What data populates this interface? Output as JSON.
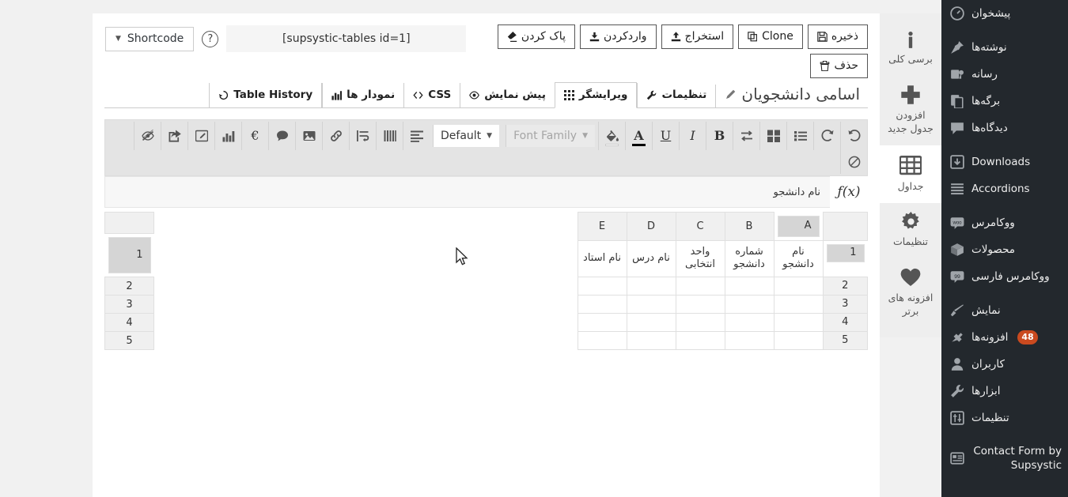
{
  "wp_sidebar": {
    "items": [
      {
        "label": "پیشخوان",
        "icon": "dashboard-icon",
        "badge": null
      },
      {
        "label": "نوشته‌ها",
        "icon": "pin-icon",
        "badge": null
      },
      {
        "label": "رسانه",
        "icon": "media-icon",
        "badge": null
      },
      {
        "label": "برگه‌ها",
        "icon": "pages-icon",
        "badge": null
      },
      {
        "label": "دیدگاه‌ها",
        "icon": "comment-icon",
        "badge": null
      },
      {
        "label": "Downloads",
        "icon": "download-icon",
        "badge": null
      },
      {
        "label": "Accordions",
        "icon": "list-icon",
        "badge": null
      },
      {
        "label": "ووکامرس",
        "icon": "woo-icon",
        "badge": null
      },
      {
        "label": "محصولات",
        "icon": "box-icon",
        "badge": null
      },
      {
        "label": "ووکامرس فارسی",
        "icon": "woo-fa-icon",
        "badge": null
      },
      {
        "label": "نمایش",
        "icon": "appearance-icon",
        "badge": null
      },
      {
        "label": "افزونه‌ها",
        "icon": "plugin-icon",
        "badge": "48"
      },
      {
        "label": "کاربران",
        "icon": "users-icon",
        "badge": null
      },
      {
        "label": "ابزارها",
        "icon": "tools-icon",
        "badge": null
      },
      {
        "label": "تنظیمات",
        "icon": "settings-icon",
        "badge": null
      },
      {
        "label": "Contact Form by Supsystic",
        "icon": "contact-form-icon",
        "badge": null
      }
    ]
  },
  "rail": {
    "items": [
      {
        "label": "برسی کلی",
        "icon": "info-icon",
        "active": false
      },
      {
        "label": "افزودن جدول جدید",
        "icon": "plus-icon",
        "active": false
      },
      {
        "label": "جداول",
        "icon": "table-icon",
        "active": true
      },
      {
        "label": "تنظیمات",
        "icon": "gear-icon",
        "active": false
      },
      {
        "label": "افزونه های برتر",
        "icon": "heart-icon",
        "active": false
      }
    ]
  },
  "shortcode": {
    "select_label": "Shortcode",
    "help_label": "?",
    "value": "[supsystic-tables id=1]"
  },
  "actions": [
    {
      "label": "ذخیره",
      "icon": "save-icon"
    },
    {
      "label": "Clone",
      "icon": "clone-icon"
    },
    {
      "label": "استخراج",
      "icon": "export-icon"
    },
    {
      "label": "واردکردن",
      "icon": "import-icon"
    },
    {
      "label": "پاک کردن",
      "icon": "eraser-icon"
    },
    {
      "label": "حذف",
      "icon": "trash-icon"
    }
  ],
  "table_title": "اسامی دانشجویان",
  "tabs": [
    {
      "label": "تنظیمات",
      "icon": "wrench-icon",
      "active": false
    },
    {
      "label": "ویرایشگر",
      "icon": "grid-icon",
      "active": true
    },
    {
      "label": "پیش نمایش",
      "icon": "eye-icon",
      "active": false
    },
    {
      "label": "CSS",
      "icon": "code-icon",
      "active": false
    },
    {
      "label": "نمودار ها",
      "icon": "chart-icon",
      "active": false
    },
    {
      "label": "Table History",
      "icon": "history-icon",
      "active": false
    }
  ],
  "toolbar": {
    "right_group": [
      {
        "icon": "undo-icon",
        "name": "undo-button"
      },
      {
        "icon": "redo-icon",
        "name": "redo-button"
      },
      {
        "icon": "list-icon",
        "name": "list-button"
      },
      {
        "icon": "merge-cells-icon",
        "name": "merge-cells-button"
      },
      {
        "icon": "swap-icon",
        "name": "swap-button"
      },
      {
        "icon": "bold-icon",
        "name": "bold-button",
        "letter": "B"
      },
      {
        "icon": "italic-icon",
        "name": "italic-button",
        "letter": "I"
      },
      {
        "icon": "underline-icon",
        "name": "underline-button",
        "letter": "U"
      },
      {
        "icon": "text-color-icon",
        "name": "text-color-button",
        "letter": "A",
        "swatch": "#000000"
      },
      {
        "icon": "fill-color-icon",
        "name": "fill-color-button",
        "swatch": "#ffffff"
      }
    ],
    "font_family_label": "Font Family",
    "default_label": "Default",
    "left_group": [
      {
        "icon": "align-icon",
        "name": "align-button"
      },
      {
        "icon": "columns-icon",
        "name": "columns-button"
      },
      {
        "icon": "wrap-text-icon",
        "name": "wrap-text-button"
      },
      {
        "icon": "link-icon",
        "name": "link-button"
      },
      {
        "icon": "image-icon",
        "name": "image-button"
      },
      {
        "icon": "comment-icon",
        "name": "comment-button"
      },
      {
        "icon": "currency-icon",
        "name": "currency-button",
        "letter": "€"
      },
      {
        "icon": "chart-bar-icon",
        "name": "chart-button"
      },
      {
        "icon": "edit-icon",
        "name": "edit-button"
      },
      {
        "icon": "share-icon",
        "name": "share-button"
      },
      {
        "icon": "hide-icon",
        "name": "hide-button"
      }
    ],
    "second_row": [
      {
        "icon": "ban-icon",
        "name": "clear-format-button"
      }
    ]
  },
  "formula_bar": {
    "fx_label": "ƒ(x)",
    "value": "نام دانشجو"
  },
  "sheet": {
    "columns": [
      "A",
      "B",
      "C",
      "D",
      "E"
    ],
    "selected_column": "A",
    "rows": [
      "1",
      "2",
      "3",
      "4",
      "5"
    ],
    "selected_row": "1",
    "cells": [
      [
        "نام دانشجو",
        "شماره دانشجو",
        "واحد انتخابی",
        "نام درس",
        "نام استاد"
      ],
      [
        "",
        "",
        "",
        "",
        ""
      ],
      [
        "",
        "",
        "",
        "",
        ""
      ],
      [
        "",
        "",
        "",
        "",
        ""
      ],
      [
        "",
        "",
        "",
        "",
        ""
      ]
    ]
  },
  "colors": {
    "wp_sidebar_bg": "#23282d",
    "page_bg": "#f1f1f1",
    "badge_bg": "#ca4a1f",
    "rail_bg": "#eeeeee",
    "toolbar_bg": "#e4e4e4"
  }
}
